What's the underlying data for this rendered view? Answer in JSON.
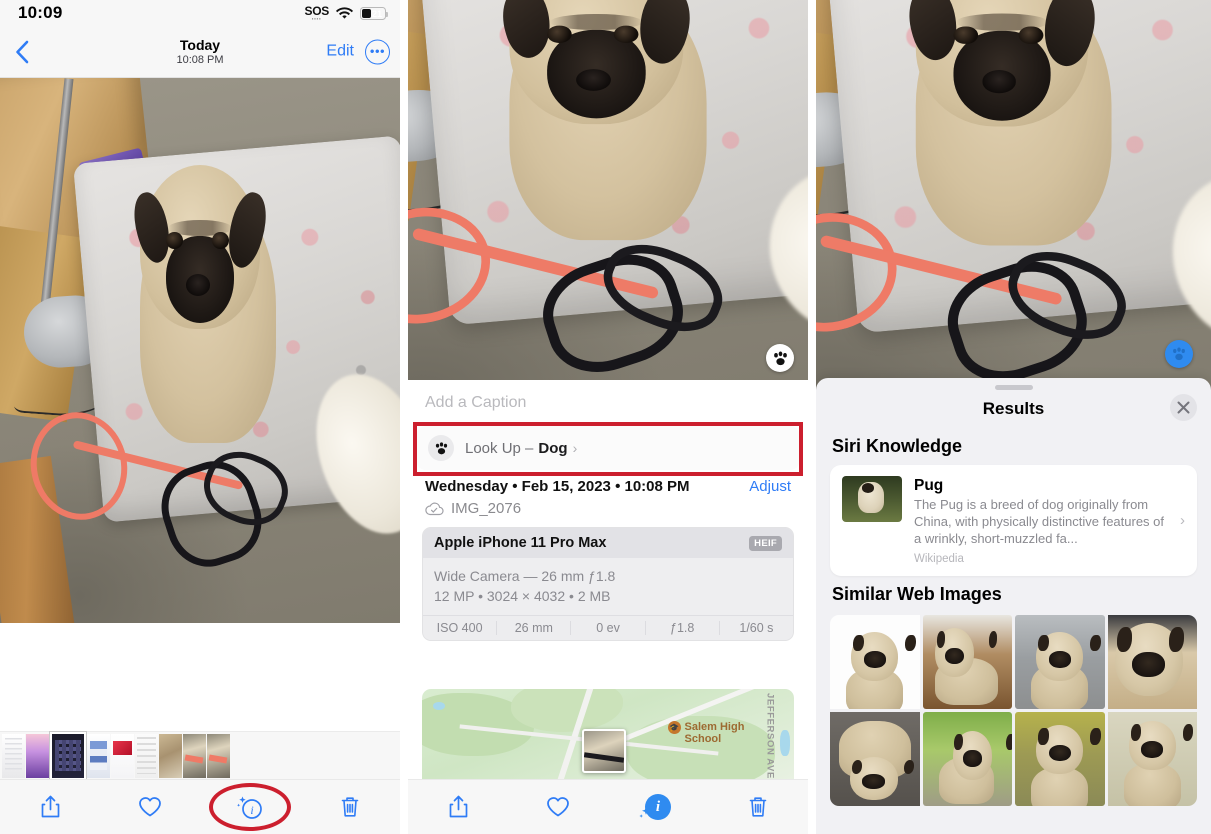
{
  "status_bar": {
    "time": "10:09",
    "sos_label": "SOS",
    "wifi_icon": "wifi-icon",
    "battery_level": "21"
  },
  "nav_bar": {
    "back_icon": "chevron-left-icon",
    "title": "Today",
    "subtitle": "10:08 PM",
    "edit_label": "Edit",
    "more_icon": "ellipsis-icon"
  },
  "photo": {
    "subject": "pug dog sitting on pet bed",
    "paw_badge_icon": "paw-icon"
  },
  "toolbar": {
    "share_icon": "share-icon",
    "favorite_icon": "heart-icon",
    "info_icon": "info-sparkle-icon",
    "delete_icon": "trash-icon"
  },
  "annotations": {
    "info_button_highlight_color": "#cc1f2e",
    "lookup_row_highlight_color": "#cc1f2e"
  },
  "detail": {
    "caption_placeholder": "Add a Caption",
    "lookup": {
      "icon": "paw-icon",
      "prefix": "Look Up –",
      "subject": "Dog",
      "chevron": "›"
    },
    "date_line": "Wednesday • Feb 15, 2023 • 10:08 PM",
    "adjust_label": "Adjust",
    "cloud_icon": "cloud-check-icon",
    "filename": "IMG_2076",
    "exif": {
      "device": "Apple iPhone 11 Pro Max",
      "format_badge": "HEIF",
      "lens_line": "Wide Camera — 26 mm ƒ1.8",
      "size_line": "12 MP • 3024 × 4032 • 2 MB",
      "stats": [
        "ISO 400",
        "26 mm",
        "0 ev",
        "ƒ1.8",
        "1/60 s"
      ]
    },
    "map": {
      "poi_label": "Salem High School",
      "street_label": "JEFFERSON AVE",
      "pin_icon": "photo-pin-icon"
    }
  },
  "results_sheet": {
    "handle_icon": "drag-handle-icon",
    "title": "Results",
    "close_icon": "close-icon",
    "sections": [
      {
        "heading": "Siri Knowledge",
        "card": {
          "name": "Pug",
          "description": "The Pug is a breed of dog originally from China, with physically distinctive features of a wrinkly, short-muzzled fa...",
          "source": "Wikipedia",
          "chevron": "›",
          "thumb_icon": "pug-photo"
        }
      },
      {
        "heading": "Similar Web Images",
        "images": [
          "pug-lying-white-bg",
          "pug-standing-rug",
          "pug-sitting-pavement",
          "pug-closeup-blanket",
          "pug-head-down",
          "pug-sitting-grass",
          "pug-collar-field",
          "pug-standing-pale"
        ]
      }
    ]
  }
}
